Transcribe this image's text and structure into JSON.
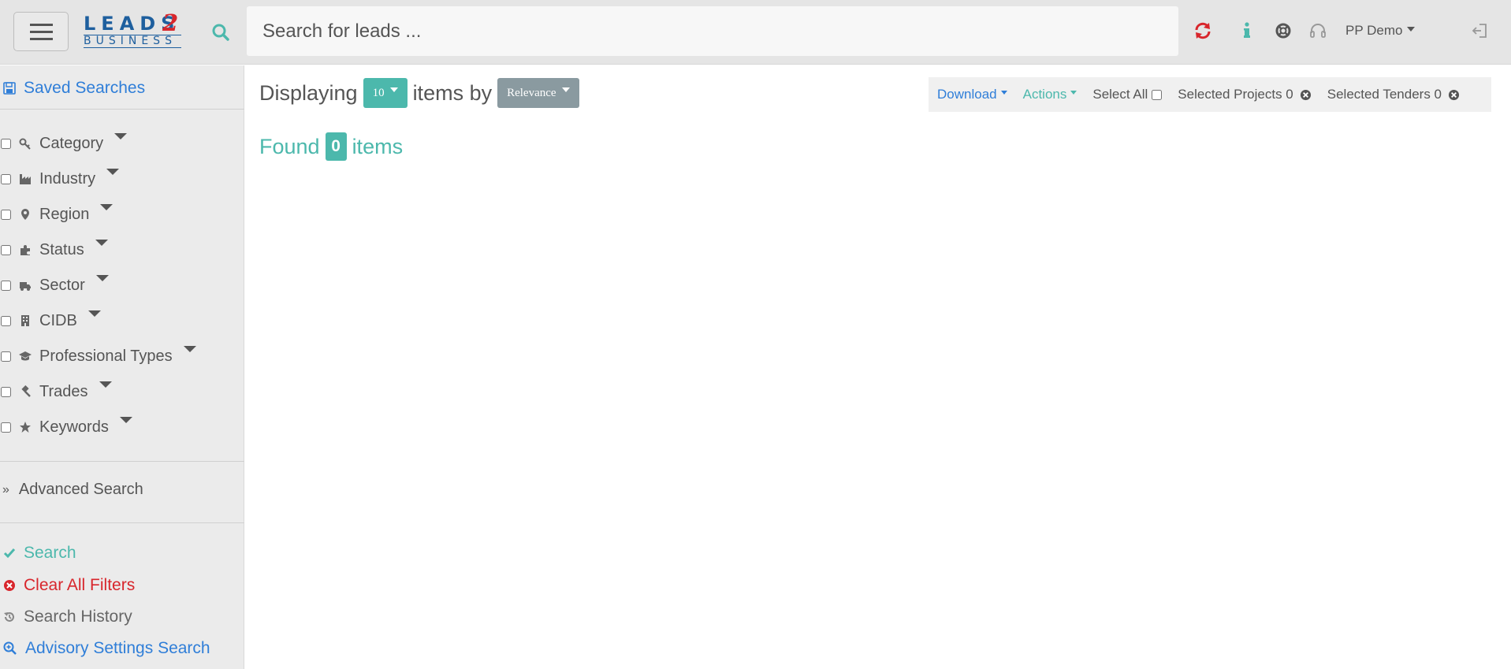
{
  "header": {
    "logo": {
      "top": "LEADS",
      "two": "2",
      "bottom": "BUSINESS"
    },
    "search_placeholder": "Search for leads ...",
    "user_label": "PP Demo",
    "icons": [
      "menu-icon",
      "search-icon",
      "refresh-icon",
      "info-icon",
      "lifebuoy-icon",
      "headset-icon",
      "logout-icon"
    ],
    "accent_color": "#4cb8ac",
    "refresh_color": "#d8262c"
  },
  "sidebar": {
    "saved_searches": "Saved Searches",
    "filters": [
      {
        "label": "Category",
        "icon": "key-icon"
      },
      {
        "label": "Industry",
        "icon": "industry-icon"
      },
      {
        "label": "Region",
        "icon": "map-marker-icon"
      },
      {
        "label": "Status",
        "icon": "puzzle-icon"
      },
      {
        "label": "Sector",
        "icon": "truck-icon"
      },
      {
        "label": "CIDB",
        "icon": "building-icon"
      },
      {
        "label": "Professional Types",
        "icon": "graduation-cap-icon"
      },
      {
        "label": "Trades",
        "icon": "gavel-icon"
      },
      {
        "label": "Keywords",
        "icon": "star-icon"
      }
    ],
    "advanced_search": "Advanced Search",
    "search": "Search",
    "clear_all": "Clear All Filters",
    "search_history": "Search History",
    "advisory_search": "Advisory Settings Search"
  },
  "main": {
    "displaying": "Displaying",
    "page_size": "10",
    "items_by": "items by",
    "sort_by": "Relevance",
    "found": "Found",
    "found_count": "0",
    "items": "items"
  },
  "toolbar": {
    "download": "Download",
    "actions": "Actions",
    "select_all": "Select All",
    "selected_projects": "Selected Projects 0",
    "selected_tenders": "Selected Tenders 0"
  }
}
